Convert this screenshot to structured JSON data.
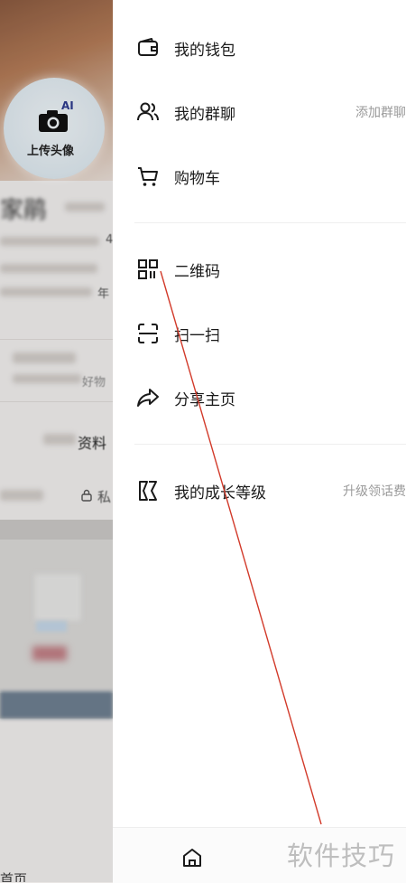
{
  "background_profile": {
    "avatar_badge": "AI",
    "upload_avatar_label": "上传头像",
    "name_fragment": "家鹃",
    "row1_suffix": "4",
    "row3_suffix": "年",
    "goods_suffix": "好物",
    "tab_label": "资料",
    "privacy_label": "私",
    "bottom_nav_home": "首页"
  },
  "menu": {
    "wallet": {
      "label": "我的钱包",
      "icon": "wallet-icon"
    },
    "group_chat": {
      "label": "我的群聊",
      "hint": "添加群聊",
      "icon": "users-icon"
    },
    "cart": {
      "label": "购物车",
      "icon": "shopping-cart-icon"
    },
    "qr_code": {
      "label": "二维码",
      "icon": "qr-code-icon"
    },
    "scan": {
      "label": "扫一扫",
      "icon": "scan-icon"
    },
    "share": {
      "label": "分享主页",
      "icon": "share-arrow-icon"
    },
    "growth": {
      "label": "我的成长等级",
      "hint": "升级领话费",
      "icon": "level-k-icon"
    }
  },
  "bottom_bar": {
    "icon": "home-icon"
  },
  "watermark": "软件技巧",
  "colors": {
    "annotation_line": "#d23a2a",
    "drawer_bg": "#ffffff",
    "hint_text": "#9a9a9a"
  }
}
